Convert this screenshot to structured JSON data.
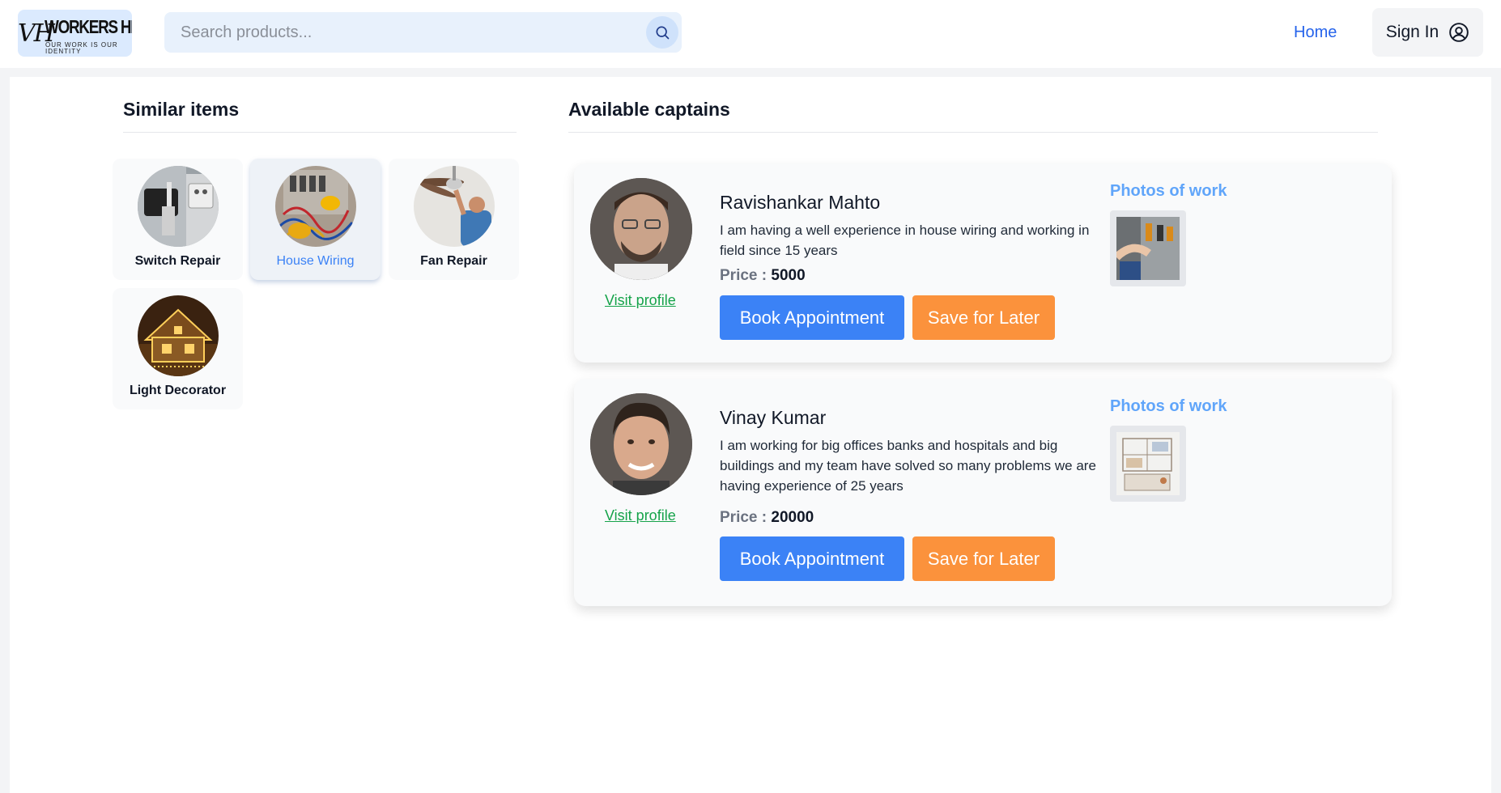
{
  "header": {
    "logo": {
      "mark": "VH",
      "name": "WORKERS HIVE",
      "tagline": "OUR WORK IS OUR IDENTITY"
    },
    "search": {
      "placeholder": "Search products..."
    },
    "nav": {
      "home": "Home",
      "sign_in": "Sign In"
    }
  },
  "similar": {
    "title": "Similar items",
    "items": [
      {
        "label": "Switch Repair",
        "selected": false
      },
      {
        "label": "House Wiring",
        "selected": true
      },
      {
        "label": "Fan Repair",
        "selected": false
      },
      {
        "label": "Light Decorator",
        "selected": false
      }
    ]
  },
  "captains": {
    "title": "Available captains",
    "list": [
      {
        "name": "Ravishankar Mahto",
        "description": "I am having a well experience in house wiring and working in field since 15 years",
        "price_label": "Price :",
        "price": "5000",
        "visit_label": "Visit profile",
        "book_label": "Book Appointment",
        "save_label": "Save for Later",
        "photos_title": "Photos of work"
      },
      {
        "name": "Vinay Kumar",
        "description": "I am working for big offices banks and hospitals and big buildings and my team have solved so many problems we are having experience of 25 years",
        "price_label": "Price :",
        "price": "20000",
        "visit_label": "Visit profile",
        "book_label": "Book Appointment",
        "save_label": "Save for Later",
        "photos_title": "Photos of work"
      }
    ]
  },
  "colors": {
    "primary": "#3b82f6",
    "save": "#fb923c",
    "link_green": "#16a34a",
    "photos_title": "#60a5fa"
  }
}
